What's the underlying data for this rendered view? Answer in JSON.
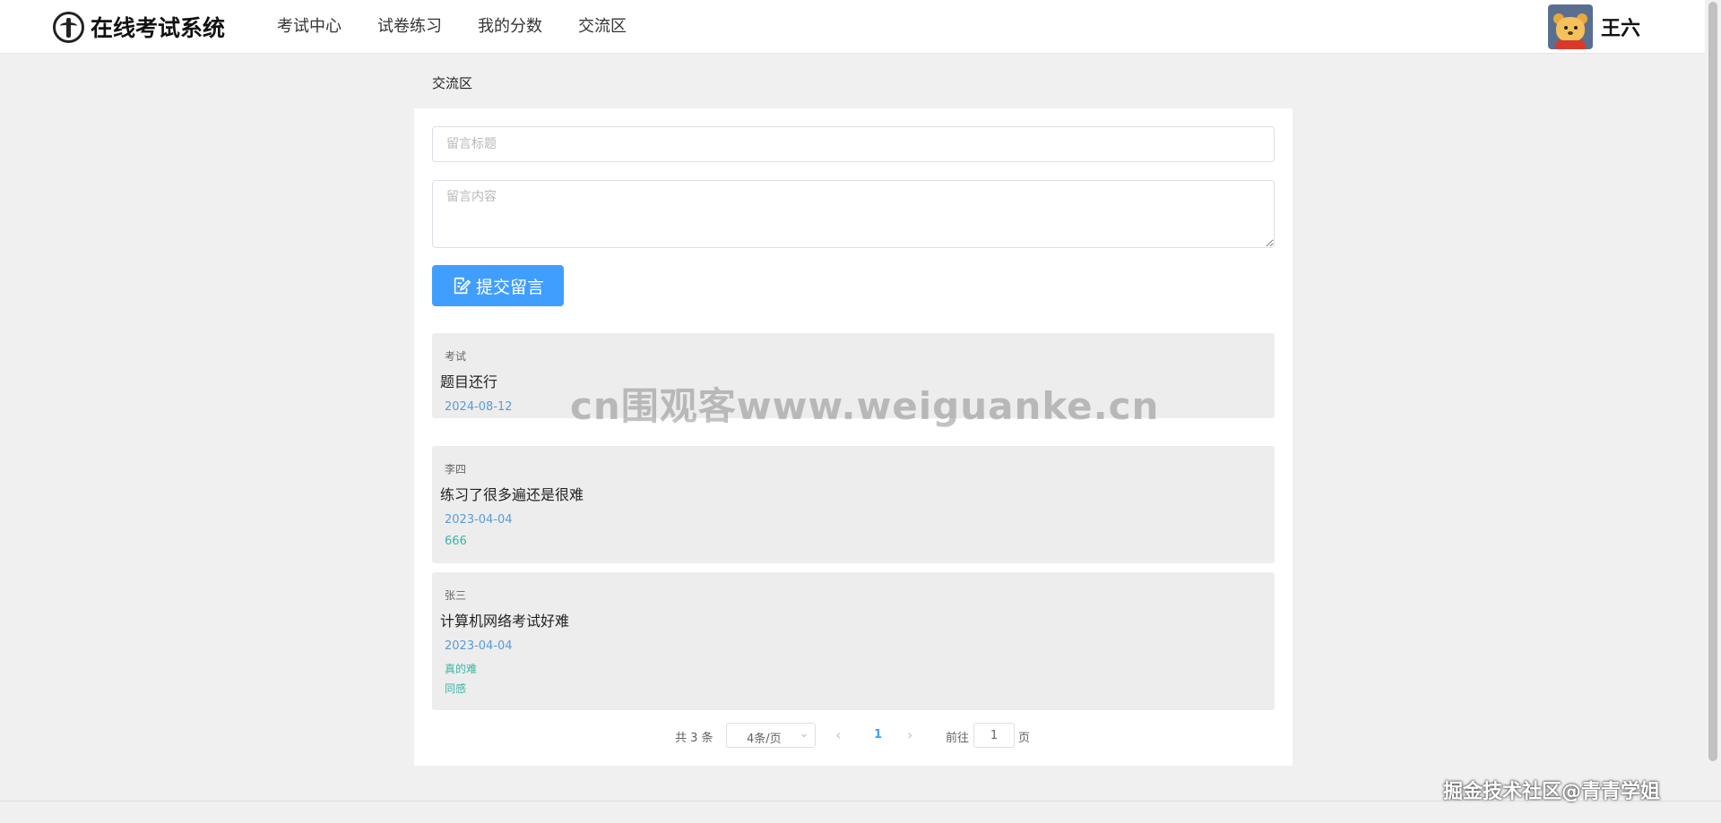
{
  "app": {
    "logo_text": "在线考试系统"
  },
  "nav": {
    "items": [
      {
        "label": "考试中心"
      },
      {
        "label": "试卷练习"
      },
      {
        "label": "我的分数"
      },
      {
        "label": "交流区"
      }
    ]
  },
  "user": {
    "name": "王六"
  },
  "page": {
    "title": "交流区"
  },
  "form": {
    "title_placeholder": "留言标题",
    "content_placeholder": "留言内容",
    "submit_label": "提交留言"
  },
  "messages": [
    {
      "author": "考试",
      "title": "题目还行",
      "date": "2024-08-12",
      "replies": []
    },
    {
      "author": "李四",
      "title": "练习了很多遍还是很难",
      "date": "2023-04-04",
      "replies": [
        "666"
      ]
    },
    {
      "author": "张三",
      "title": "计算机网络考试好难",
      "date": "2023-04-04",
      "replies": [
        "真的难",
        "同感"
      ]
    }
  ],
  "pagination": {
    "total": "共 3 条",
    "page_size": "4条/页",
    "current_page": "1",
    "goto_label": "前往",
    "goto_value": "1",
    "page_unit": "页"
  },
  "watermarks": {
    "center": "cn围观客www.weiguanke.cn",
    "bottom_right": "掘金技术社区@青青学姐"
  },
  "colors": {
    "primary": "#409eff",
    "date": "#5a9bd5",
    "reply": "#3ab5a5"
  }
}
